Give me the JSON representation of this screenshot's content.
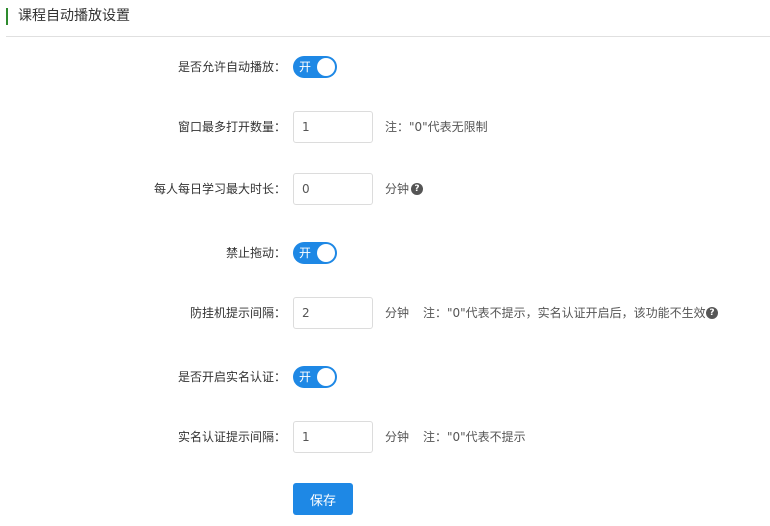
{
  "header": {
    "title": "课程自动播放设置"
  },
  "form": {
    "autoplay": {
      "label": "是否允许自动播放：",
      "toggle_text": "开"
    },
    "max_windows": {
      "label": "窗口最多打开数量：",
      "value": "1",
      "note": "注：\"0\"代表无限制"
    },
    "daily_max": {
      "label": "每人每日学习最大时长：",
      "value": "0",
      "unit": "分钟"
    },
    "no_drag": {
      "label": "禁止拖动：",
      "toggle_text": "开"
    },
    "anti_idle": {
      "label": "防挂机提示间隔：",
      "value": "2",
      "unit": "分钟",
      "note": "注：\"0\"代表不提示，实名认证开启后，该功能不生效"
    },
    "realname": {
      "label": "是否开启实名认证：",
      "toggle_text": "开"
    },
    "realname_interval": {
      "label": "实名认证提示间隔：",
      "value": "1",
      "unit": "分钟",
      "note": "注：\"0\"代表不提示"
    }
  },
  "actions": {
    "save_label": "保存"
  },
  "icons": {
    "help": "question-circle-icon"
  },
  "colors": {
    "accent": "#1e88e5",
    "header_bar": "#2e8b2e"
  }
}
